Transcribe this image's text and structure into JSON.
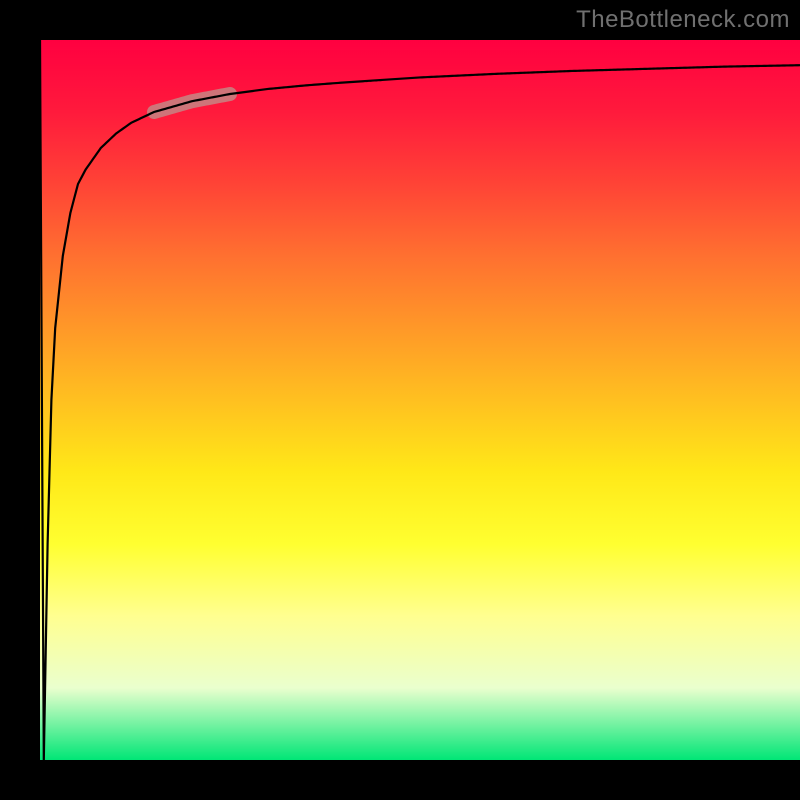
{
  "watermark": "TheBottleneck.com",
  "colors": {
    "frame": "#000000",
    "gradient_top": "#ff0040",
    "gradient_mid": "#ffe818",
    "gradient_bottom": "#00e676",
    "curve": "#000000",
    "highlight": "#c98080"
  },
  "chart_data": {
    "type": "line",
    "title": "",
    "xlabel": "",
    "ylabel": "",
    "xlim": [
      0,
      100
    ],
    "ylim": [
      0,
      100
    ],
    "grid": false,
    "legend": false,
    "series": [
      {
        "name": "curve",
        "color": "#000000",
        "x": [
          0,
          0.5,
          1,
          1.5,
          2,
          3,
          4,
          5,
          6,
          8,
          10,
          12,
          15,
          20,
          25,
          30,
          35,
          40,
          50,
          60,
          70,
          80,
          90,
          100
        ],
        "y": [
          100,
          0,
          30,
          50,
          60,
          70,
          76,
          80,
          82,
          85,
          87,
          88.5,
          90,
          91.5,
          92.5,
          93.2,
          93.7,
          94.1,
          94.8,
          95.3,
          95.7,
          96,
          96.3,
          96.5
        ]
      }
    ],
    "highlight_segment": {
      "series": "curve",
      "x_range": [
        15,
        25
      ],
      "color": "#c98080",
      "width": 14
    },
    "annotations": []
  }
}
